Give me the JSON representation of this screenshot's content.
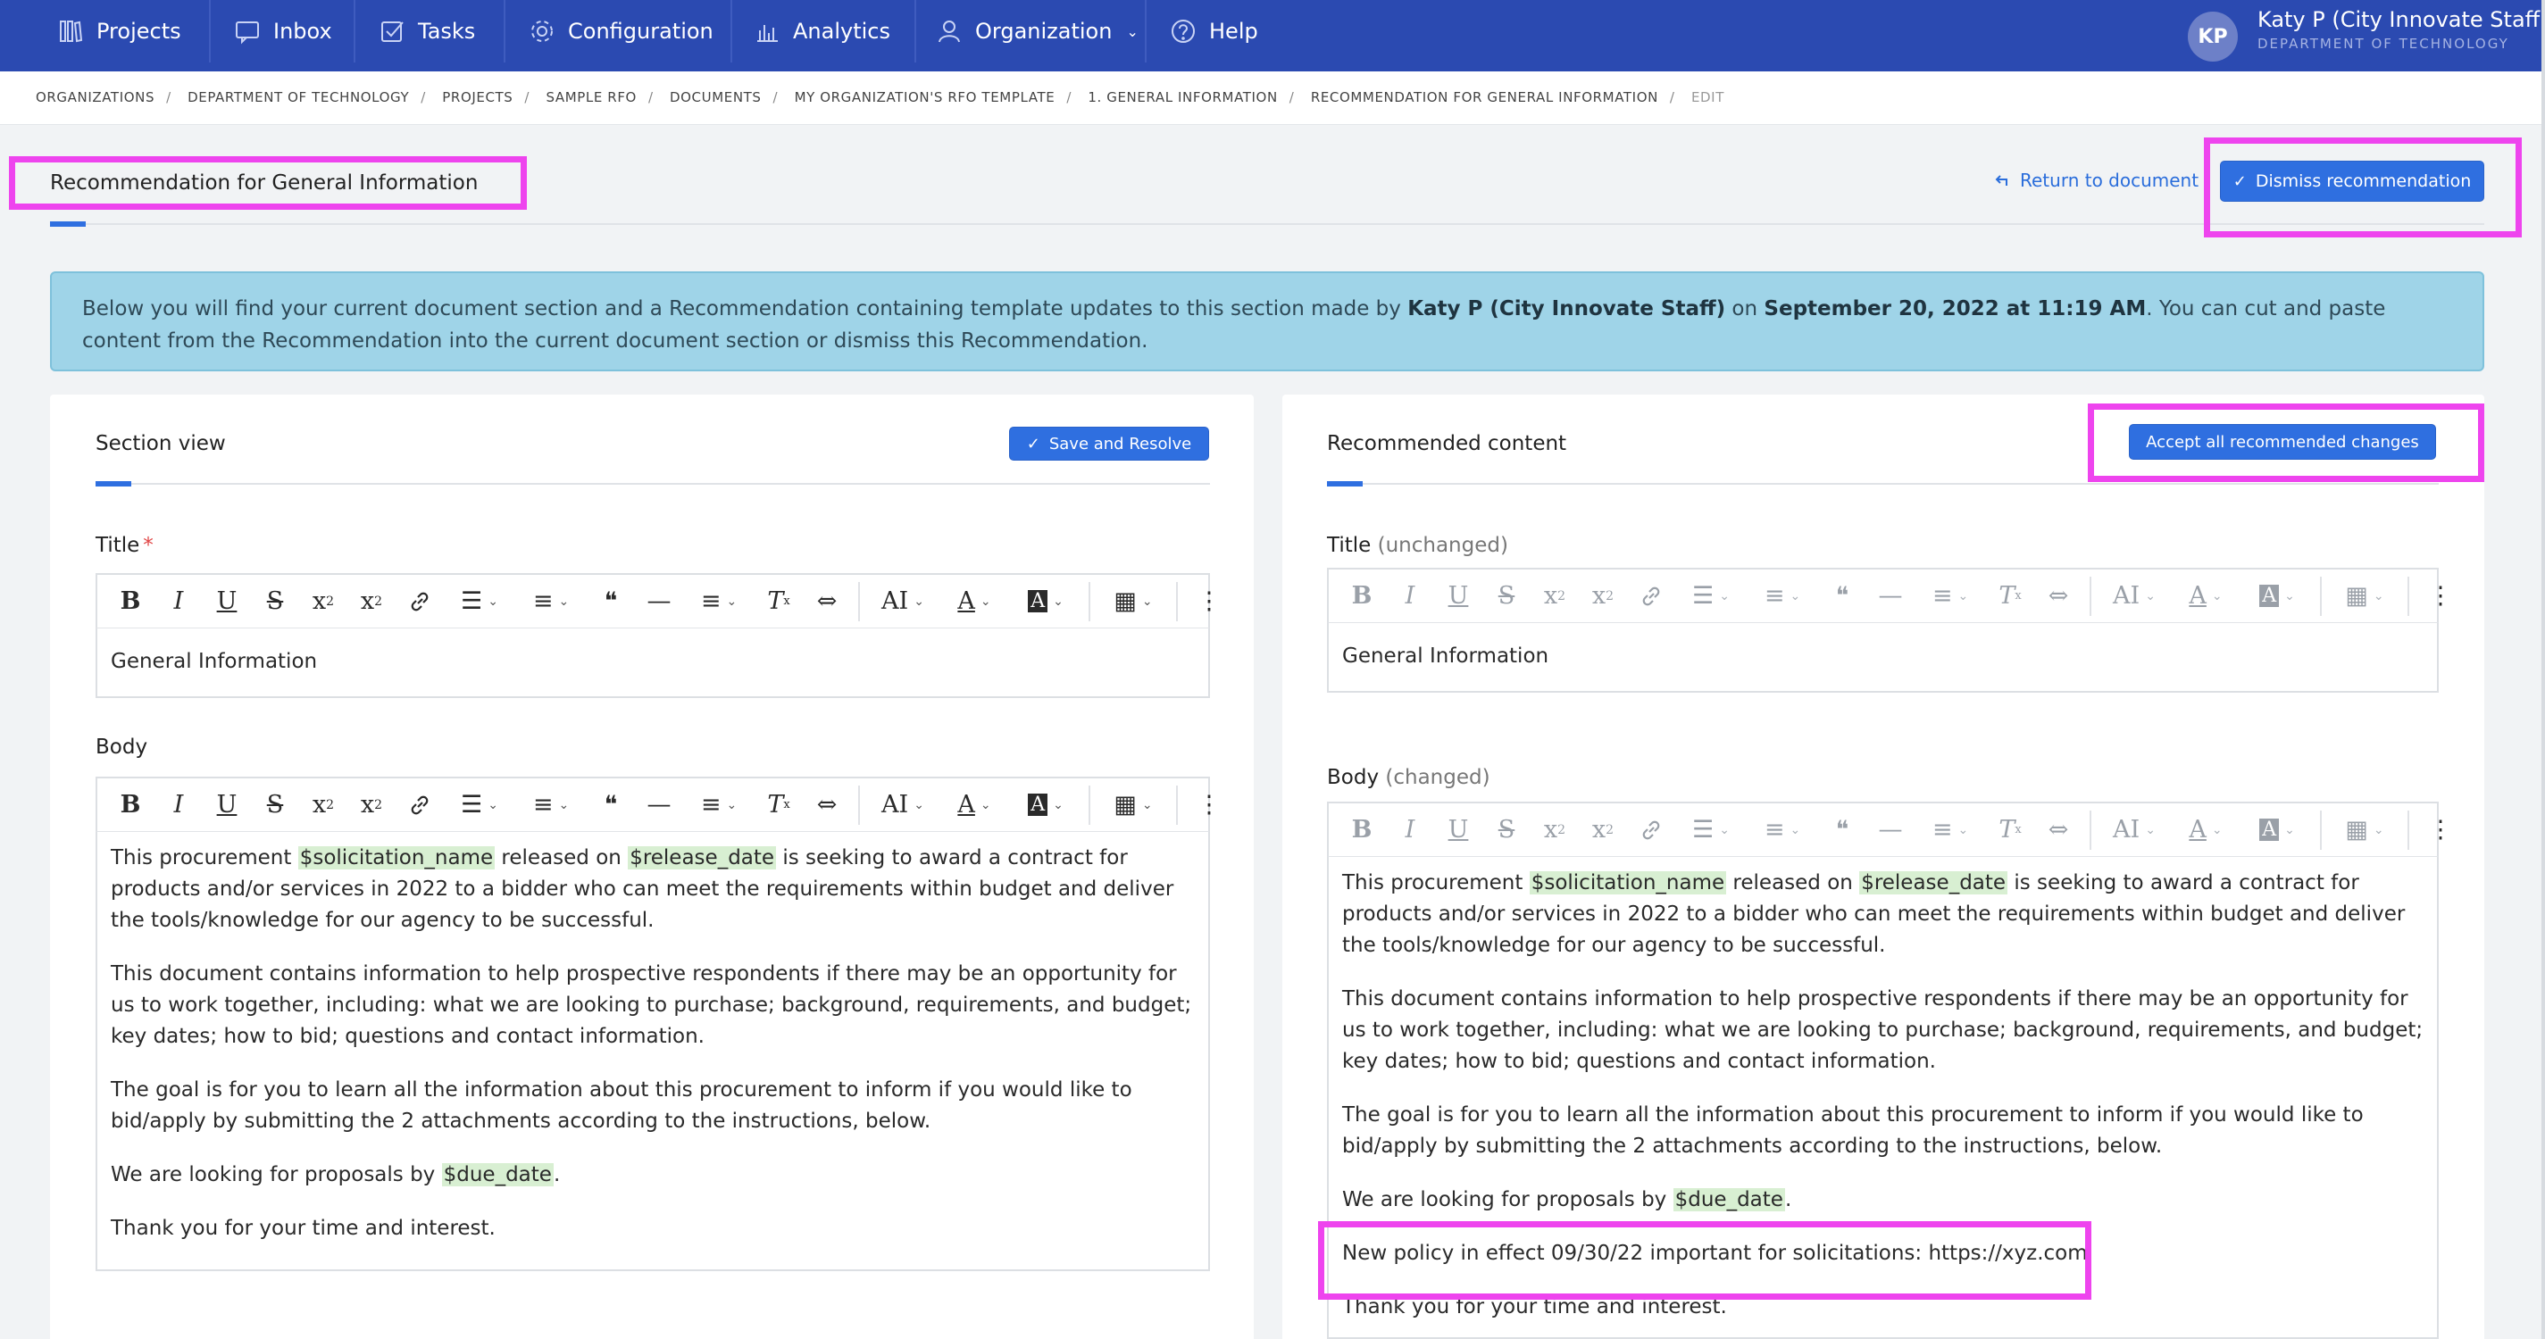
{
  "nav": {
    "items": [
      {
        "label": "Projects",
        "icon": "projects-icon"
      },
      {
        "label": "Inbox",
        "icon": "inbox-icon"
      },
      {
        "label": "Tasks",
        "icon": "tasks-icon"
      },
      {
        "label": "Configuration",
        "icon": "gear-icon"
      },
      {
        "label": "Analytics",
        "icon": "bar-chart-icon"
      },
      {
        "label": "Organization",
        "icon": "organization-icon"
      },
      {
        "label": "Help",
        "icon": "help-icon"
      }
    ],
    "user": {
      "initials": "KP",
      "name": "Katy P (City Innovate Staff)",
      "department": "DEPARTMENT OF TECHNOLOGY"
    }
  },
  "breadcrumb": [
    "ORGANIZATIONS",
    "DEPARTMENT OF TECHNOLOGY",
    "PROJECTS",
    "SAMPLE RFO",
    "DOCUMENTS",
    "MY ORGANIZATION'S RFO TEMPLATE",
    "1. GENERAL INFORMATION",
    "RECOMMENDATION FOR GENERAL INFORMATION",
    "EDIT"
  ],
  "page": {
    "title": "Recommendation for General Information",
    "return_link": "Return to document",
    "dismiss_button": "Dismiss recommendation"
  },
  "banner": {
    "text_1": "Below you will find your current document section and a Recommendation containing template updates to this section made by ",
    "author": "Katy P (City Innovate Staff)",
    "text_2": " on ",
    "date": "September 20, 2022 at 11:19 AM",
    "text_3": ". You can cut and paste content from the Recommendation into the current document section or dismiss this Recommendation."
  },
  "left": {
    "heading": "Section view",
    "save_button": "Save and Resolve",
    "title_label": "Title",
    "required_mark": "*",
    "title_value": "General Information",
    "body_label": "Body",
    "body": {
      "p1_a": "This procurement ",
      "var_solicitation": "$solicitation_name",
      "p1_b": " released on ",
      "var_release": "$release_date",
      "p1_c": " is seeking to award a contract for products and/or services in 2022 to a bidder who can meet the requirements within budget and deliver the tools/knowledge for our agency to be successful.",
      "p2": "This document contains information to help prospective respondents if there may be an opportunity for us to work together, including: what we are looking to purchase; background, requirements, and budget; key dates; how to bid; questions and contact information.",
      "p3": "The goal is for you to learn all the information about this procurement to inform if you would like to bid/apply by submitting the 2 attachments according to the instructions, below.",
      "p4_a": "We are looking for proposals by ",
      "var_due": "$due_date",
      "p4_b": ".",
      "p5": "Thank you for your time and interest."
    }
  },
  "right": {
    "heading": "Recommended content",
    "accept_button": "Accept all recommended changes",
    "title_label": "Title",
    "title_status": "(unchanged)",
    "title_value": "General Information",
    "body_label": "Body",
    "body_status": "(changed)",
    "body": {
      "p1_a": "This procurement ",
      "var_solicitation": "$solicitation_name",
      "p1_b": " released on ",
      "var_release": "$release_date",
      "p1_c": " is seeking to award a contract for products and/or services in 2022 to a bidder who can meet the requirements within budget and deliver the tools/knowledge for our agency to be successful.",
      "p2": "This document contains information to help prospective respondents if there may be an opportunity for us to work together, including: what we are looking to purchase; background, requirements, and budget; key dates; how to bid; questions and contact information.",
      "p3": "The goal is for you to learn all the information about this procurement to inform if you would like to bid/apply by submitting the 2 attachments according to the instructions, below.",
      "p4_a": "We are looking for proposals by ",
      "var_due": "$due_date",
      "p4_b": ".",
      "p_new": "New policy in effect 09/30/22 important for solicitations: https://xyz.com",
      "p5": "Thank you for your time and interest."
    }
  },
  "toolbar_icons": [
    "bold-icon",
    "italic-icon",
    "underline-icon",
    "strikethrough-icon",
    "subscript-icon",
    "superscript-icon",
    "link-icon",
    "bulleted-list-icon",
    "numbered-list-icon",
    "blockquote-icon",
    "horizontal-line-icon",
    "align-icon",
    "remove-format-icon",
    "page-break-icon",
    "font-size-icon",
    "font-color-icon",
    "background-color-icon",
    "table-icon",
    "more-options-icon"
  ],
  "colors": {
    "nav": "#2b4ab1",
    "accent": "#2f6fe0",
    "highlight": "#ee44ee",
    "banner": "#9fd4e8",
    "variable": "#d8efd2"
  }
}
